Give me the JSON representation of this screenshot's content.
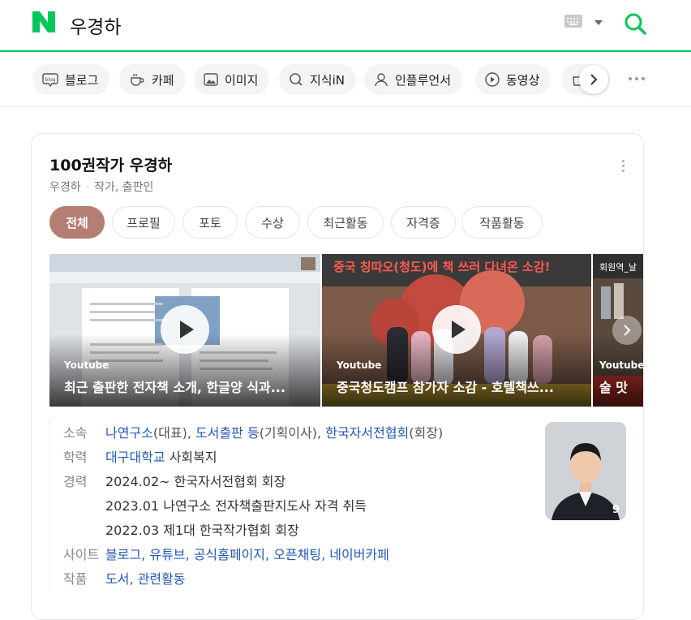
{
  "header": {
    "logo_text": "N",
    "query": "우경하",
    "colors": {
      "brand": "#03c75a"
    }
  },
  "tabs": [
    {
      "label": "블로그",
      "icon": "blog-icon"
    },
    {
      "label": "카페",
      "icon": "cafe-icon"
    },
    {
      "label": "이미지",
      "icon": "image-icon"
    },
    {
      "label": "지식iN",
      "icon": "kin-icon"
    },
    {
      "label": "인플루언서",
      "icon": "person-icon"
    },
    {
      "label": "동영상",
      "icon": "play-icon"
    },
    {
      "label": "",
      "icon": "shopping-icon"
    }
  ],
  "profile": {
    "title": "100권작가 우경하",
    "name": "우경하",
    "roles": "작가, 출판인",
    "pills": [
      "전체",
      "프로필",
      "포토",
      "수상",
      "최근활동",
      "자격증",
      "작품활동"
    ],
    "videos": [
      {
        "source": "Youtube",
        "title": "최근 출판한 전자책 소개, 한글양 식과..."
      },
      {
        "source": "Youtube",
        "title": "중국청도캠프 참가자 소감 - 호텔책쓰..."
      },
      {
        "source": "Youtube",
        "title": "술 맛"
      }
    ],
    "video_banner_text": "중국 칭따오(청도)에 책 쓰러 다녀온 소감!",
    "video_banner_text3": "회원역_날",
    "photo_count": "9",
    "info": {
      "affiliation": {
        "key": "소속",
        "link1": "나연구소",
        "role1": "(대표), ",
        "link2": "도서출판 등",
        "role2": "(기획이사), ",
        "link3": "한국자서전협회",
        "role3": "(회장)"
      },
      "education": {
        "key": "학력",
        "link": "대구대학교",
        "text": " 사회복지"
      },
      "career": {
        "key": "경력",
        "items": [
          "2024.02~ 한국자서전협회 회장",
          "2023.01 나연구소 전자책출판지도사 자격 취득",
          "2022.03 제1대 한국작가협회 회장"
        ]
      },
      "sites": {
        "key": "사이트",
        "links": [
          "블로그",
          "유튜브",
          "공식홈페이지",
          "오픈채팅",
          "네이버카페"
        ]
      },
      "works": {
        "key": "작품",
        "links": [
          "도서",
          "관련활동"
        ]
      }
    },
    "colors": {
      "active_pill": "#b47f72",
      "link": "#2559b4"
    }
  }
}
